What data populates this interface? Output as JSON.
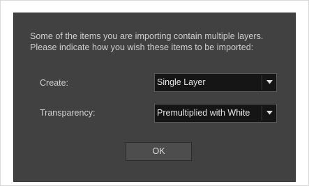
{
  "dialog": {
    "message_lines": [
      "Some of the items you are importing contain multiple layers.",
      "Please indicate how you wish these items to be imported:"
    ],
    "create": {
      "label": "Create:",
      "value": "Single Layer"
    },
    "transparency": {
      "label": "Transparency:",
      "value": "Premultiplied with White"
    },
    "ok_label": "OK"
  },
  "icons": {
    "dropdown_arrow": "chevron-down-icon"
  },
  "colors": {
    "dialog_background": "#414141",
    "combo_background": "#151515",
    "button_background": "#4d4d4d",
    "text": "#d0d0d0"
  }
}
